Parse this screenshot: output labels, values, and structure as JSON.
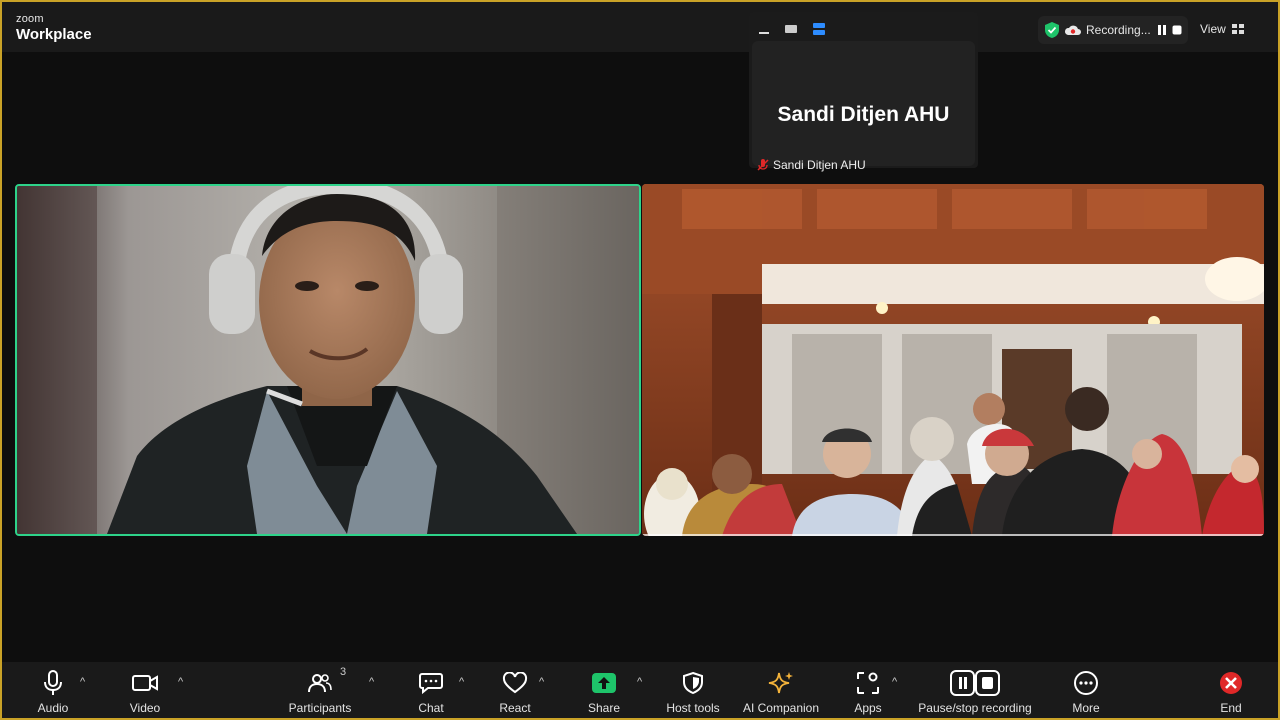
{
  "app": {
    "logo_small": "zoom",
    "logo_big": "Workplace"
  },
  "status": {
    "recording_label": "Recording...",
    "view_label": "View"
  },
  "self_view": {
    "display_name": "Sandi Ditjen AHU",
    "name_tag": "Sandi Ditjen AHU"
  },
  "toolbar": {
    "audio": "Audio",
    "video": "Video",
    "participants": "Participants",
    "participants_count": "3",
    "chat": "Chat",
    "react": "React",
    "share": "Share",
    "host_tools": "Host tools",
    "ai_companion": "AI Companion",
    "apps": "Apps",
    "pause_stop_recording": "Pause/stop recording",
    "more": "More",
    "end": "End"
  },
  "colors": {
    "active_speaker_border": "#2ed38a",
    "share_green": "#1ec46a",
    "end_red": "#e02828",
    "ai_gold": "#f3b23a",
    "window_border": "#c9a227"
  }
}
